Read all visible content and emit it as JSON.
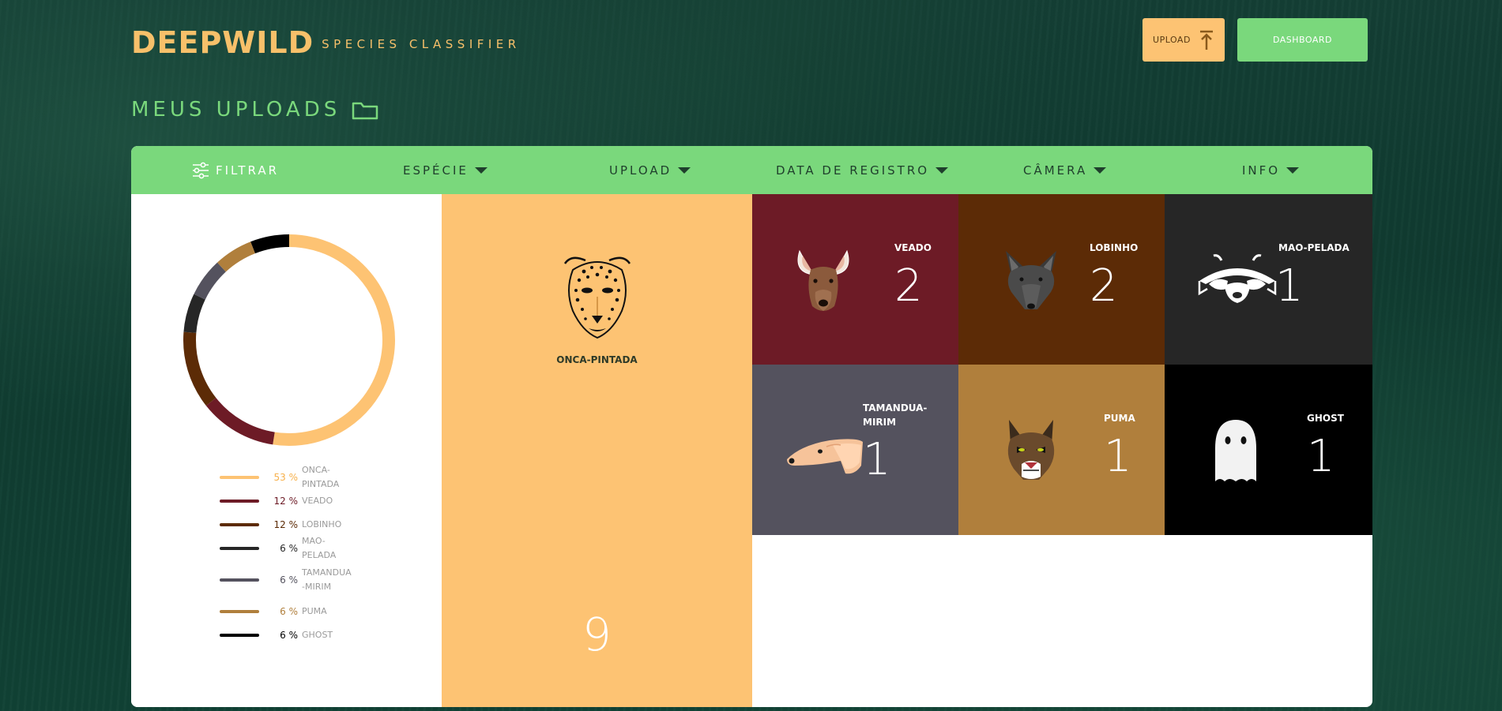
{
  "header": {
    "logo_word": "DEEPWILD",
    "logo_sub": "SPECIES CLASSIFIER",
    "upload_label": "UPLOAD",
    "dashboard_label": "DASHBOARD"
  },
  "page": {
    "title": "MEUS UPLOADS"
  },
  "filterbar": {
    "filter_label": "FILTRAR",
    "columns": [
      {
        "label": "ESPÉCIE"
      },
      {
        "label": "UPLOAD"
      },
      {
        "label": "DATA DE REGISTRO"
      },
      {
        "label": "CÂMERA"
      },
      {
        "label": "INFO"
      }
    ]
  },
  "chart_data": {
    "type": "pie",
    "donut": true,
    "categories": [
      "ONCA-PINTADA",
      "VEADO",
      "LOBINHO",
      "MAO-PELADA",
      "TAMANDUA-MIRIM",
      "PUMA",
      "GHOST"
    ],
    "values": [
      53,
      12,
      12,
      6,
      6,
      6,
      6
    ],
    "colors": [
      "#fdc373",
      "#6d1b26",
      "#5c2b06",
      "#262626",
      "#54525e",
      "#b07f3c",
      "#000000"
    ]
  },
  "legend": [
    {
      "pct": "53 %",
      "name": "ONCA-PINTADA",
      "color": "#fdc373"
    },
    {
      "pct": "12 %",
      "name": "VEADO",
      "color": "#6d1b26"
    },
    {
      "pct": "12 %",
      "name": "LOBINHO",
      "color": "#5c2b06"
    },
    {
      "pct": "6 %",
      "name": "MAO-PELADA",
      "color": "#262626"
    },
    {
      "pct": "6 %",
      "name": "TAMANDUA-MIRIM",
      "color": "#54525e"
    },
    {
      "pct": "6 %",
      "name": "PUMA",
      "color": "#b07f3c"
    },
    {
      "pct": "6 %",
      "name": "GHOST",
      "color": "#000000"
    }
  ],
  "featured": {
    "name": "ONCA-PINTADA",
    "count": "9",
    "icon": "jaguar-icon",
    "color": "#fdc373"
  },
  "tiles": [
    {
      "name": "VEADO",
      "count": "2",
      "icon": "deer-icon",
      "color": "#6d1b26"
    },
    {
      "name": "LOBINHO",
      "count": "2",
      "icon": "wolf-icon",
      "color": "#5c2b06"
    },
    {
      "name": "MAO-PELADA",
      "count": "1",
      "icon": "raccoon-icon",
      "color": "#262626"
    },
    {
      "name": "TAMANDUA-MIRIM",
      "count": "1",
      "icon": "anteater-icon",
      "color": "#54525e"
    },
    {
      "name": "PUMA",
      "count": "1",
      "icon": "puma-icon",
      "color": "#b07f3c"
    },
    {
      "name": "GHOST",
      "count": "1",
      "icon": "ghost-icon",
      "color": "#000000"
    }
  ]
}
